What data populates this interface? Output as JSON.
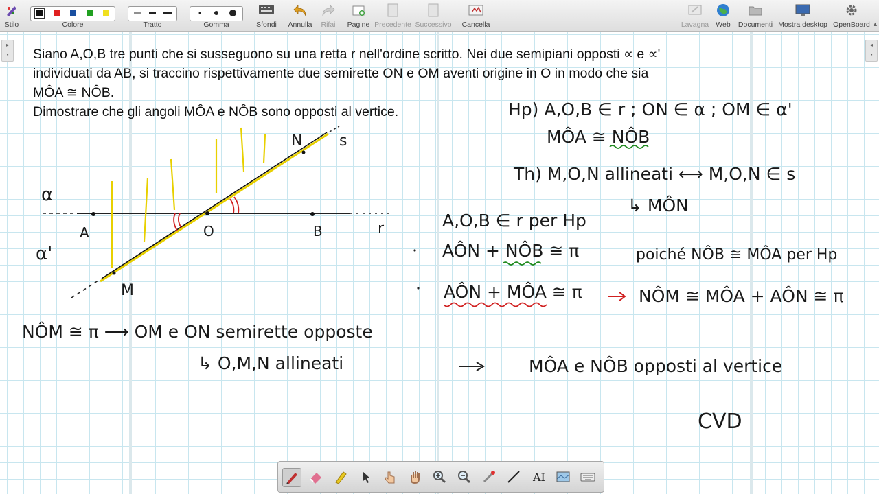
{
  "toolbar": {
    "stylus": "Stilo",
    "color": "Colore",
    "stroke": "Tratto",
    "eraser": "Gomma",
    "backgrounds": "Sfondi",
    "undo": "Annulla",
    "redo": "Rifai",
    "pages": "Pagine",
    "previous": "Precedente",
    "next": "Successivo",
    "clear": "Cancella",
    "board": "Lavagna",
    "web": "Web",
    "documents": "Documenti",
    "show_desktop": "Mostra desktop",
    "openboard": "OpenBoard"
  },
  "colors": [
    "#111111",
    "#e02020",
    "#1a4fa0",
    "#20a020",
    "#f0e020"
  ],
  "problem": {
    "line1": "Siano A,O,B tre punti che si susseguono su una retta r nell'ordine scritto. Nei due semipiani opposti ∝ e ∝'",
    "line2": "individuati da AB, si traccino rispettivamente due semirette ON e OM aventi origine in O in modo che sia",
    "line3": "MÔA ≅  NÔB.",
    "line4": "Dimostrare che gli angoli MÔA e NÔB sono opposti al vertice."
  },
  "figure": {
    "alpha": "α",
    "alpha_prime": "α'",
    "A": "A",
    "O": "O",
    "B": "B",
    "r": "r",
    "M": "M",
    "N": "N",
    "s": "s"
  },
  "notes": {
    "hp1": "Hp) A,O,B ∈ r ; ON ∈ α ; OM ∈ α'",
    "hp2": "MÔA ≅ NÔB",
    "th1": "Th) M,O,N allineati ⟷ M,O,N ∈ s",
    "th2": "↳ MÔN",
    "s1": "A,O,B ∈ r  per Hp",
    "s2a": "AÔN + NÔB ≅ π",
    "s2b": "poiché NÔB ≅ MÔA per Hp",
    "s3a": "AÔN + MÔA ≅ π",
    "s3b": "NÔM ≅ MÔA + AÔN ≅ π",
    "c1": "NÔM ≅ π  ⟶  OM e ON semirette opposte",
    "c2": "↳ O,M,N allineati",
    "c3": "MÔA e NÔB opposti al vertice",
    "cvd": "CVD"
  },
  "dock_tools": [
    "pen-icon",
    "eraser-icon",
    "marker-icon",
    "pointer-icon",
    "hand-pointer-icon",
    "hand-icon",
    "zoom-in-icon",
    "zoom-out-icon",
    "laser-icon",
    "line-icon",
    "text-icon",
    "capture-icon",
    "keyboard-icon"
  ]
}
